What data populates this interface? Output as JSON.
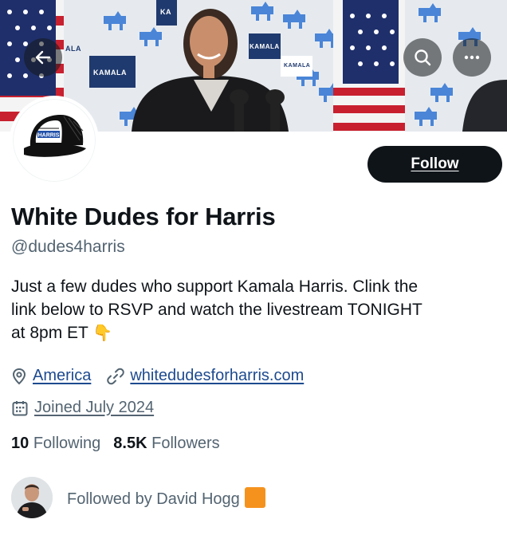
{
  "banner": {
    "signs": [
      "KAMALA",
      "KAMALA",
      "KAMALA",
      "ALA",
      "KA"
    ],
    "back_icon": "arrow-left-icon",
    "search_icon": "search-icon",
    "more_icon": "more-horizontal-icon"
  },
  "profile": {
    "avatar_text": "HARRIS",
    "follow_label": "Follow",
    "name": "White Dudes for Harris",
    "handle": "@dudes4harris",
    "bio_line1": "Just a few dudes who support Kamala Harris. Clink the",
    "bio_line2": "link below to RSVP and watch the livestream TONIGHT",
    "bio_line3": "at 8pm ET",
    "bio_emoji": "👇",
    "location": "America",
    "website": "whitedudesforharris.com",
    "joined": "Joined July 2024",
    "following_count": "10",
    "following_label": "Following",
    "followers_count": "8.5K",
    "followers_label": "Followers",
    "followed_by": "Followed by David Hogg"
  },
  "colors": {
    "text": "#0f1419",
    "muted": "#536471",
    "link": "#1d4a8f",
    "button_bg": "#0f1419",
    "accent_orange": "#f5921e",
    "flag_red": "#c8202f",
    "flag_blue": "#1f2f6b",
    "donkey_blue": "#3a7bd5"
  }
}
